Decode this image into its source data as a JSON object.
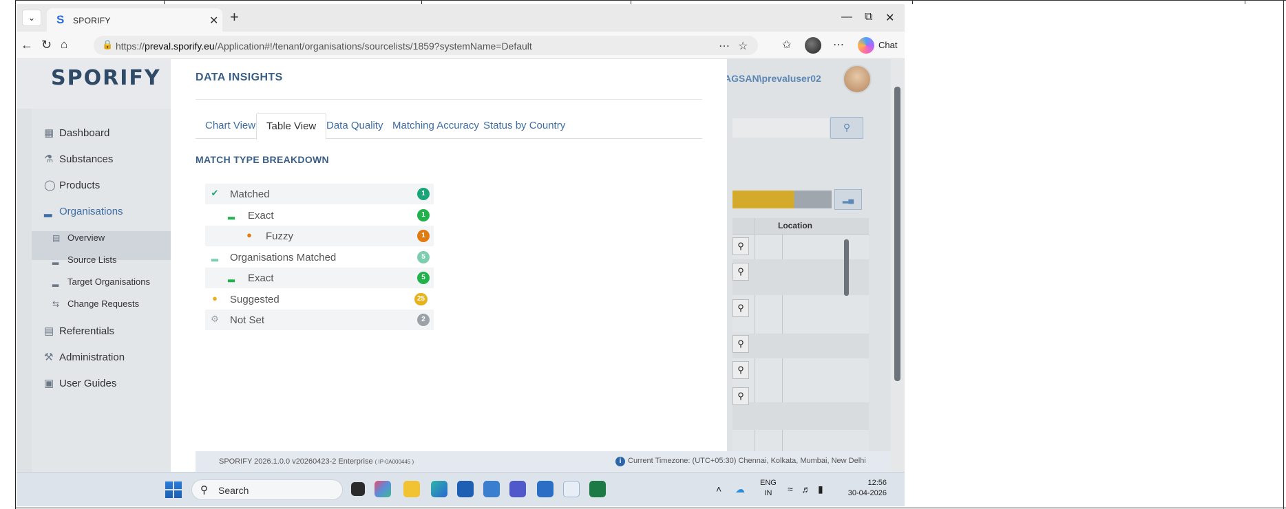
{
  "browser": {
    "tab_title": "SPORIFY",
    "url_prefix": "https://",
    "url_domain": "preval.sporify.eu",
    "url_path": "/Application#!/tenant/organisations/sourcelists/1859?systemName=Default",
    "chat_label": "Chat"
  },
  "app": {
    "brand": "SPORIFY",
    "user": "AGSAN\\prevaluser02",
    "background_table_header": "Location"
  },
  "sidebar": {
    "items": [
      {
        "label": "Dashboard",
        "icon": "grid-icon"
      },
      {
        "label": "Substances",
        "icon": "flask-icon"
      },
      {
        "label": "Products",
        "icon": "bottles-icon"
      },
      {
        "label": "Organisations",
        "icon": "factory-icon"
      },
      {
        "label": "Referentials",
        "icon": "list-icon"
      },
      {
        "label": "Administration",
        "icon": "wrench-icon"
      },
      {
        "label": "User Guides",
        "icon": "book-icon"
      }
    ],
    "sub_items": [
      {
        "label": "Overview",
        "icon": "chart-icon"
      },
      {
        "label": "Source Lists",
        "icon": "factory-icon"
      },
      {
        "label": "Target Organisations",
        "icon": "factory-icon"
      },
      {
        "label": "Change Requests",
        "icon": "swap-icon"
      }
    ]
  },
  "modal": {
    "title": "DATA INSIGHTS",
    "tabs": [
      "Chart View",
      "Table View",
      "Data Quality",
      "Matching Accuracy",
      "Status by Country"
    ],
    "active_tab": "Table View",
    "section_title": "MATCH TYPE BREAKDOWN",
    "rows": [
      {
        "label": "Matched",
        "count": "1",
        "color": "#1aa579",
        "icon": "check-circle-icon"
      },
      {
        "label": "Exact",
        "count": "1",
        "color": "#22b24c",
        "icon": "factory-icon"
      },
      {
        "label": "Fuzzy",
        "count": "1",
        "color": "#e07b12",
        "icon": "map-pin-icon"
      },
      {
        "label": "Organisations Matched",
        "count": "5",
        "color": "#7fcdb0",
        "icon": "factory-icon"
      },
      {
        "label": "Exact",
        "count": "5",
        "color": "#22b24c",
        "icon": "factory-icon"
      },
      {
        "label": "Suggested",
        "count": "25",
        "color": "#e8b21c",
        "icon": "lightbulb-icon"
      },
      {
        "label": "Not Set",
        "count": "2",
        "color": "#9aa1a8",
        "icon": "gear-icon"
      }
    ]
  },
  "footer": {
    "version": "SPORIFY 2026.1.0.0 v20260423-2 Enterprise",
    "build": "( IP-0A000445 )",
    "timezone": "Current Timezone: (UTC+05:30) Chennai, Kolkata, Mumbai, New Delhi"
  },
  "taskbar": {
    "search_label": "Search",
    "lang_top": "ENG",
    "lang_bottom": "IN",
    "time": "12:56",
    "date": "30-04-2026"
  }
}
